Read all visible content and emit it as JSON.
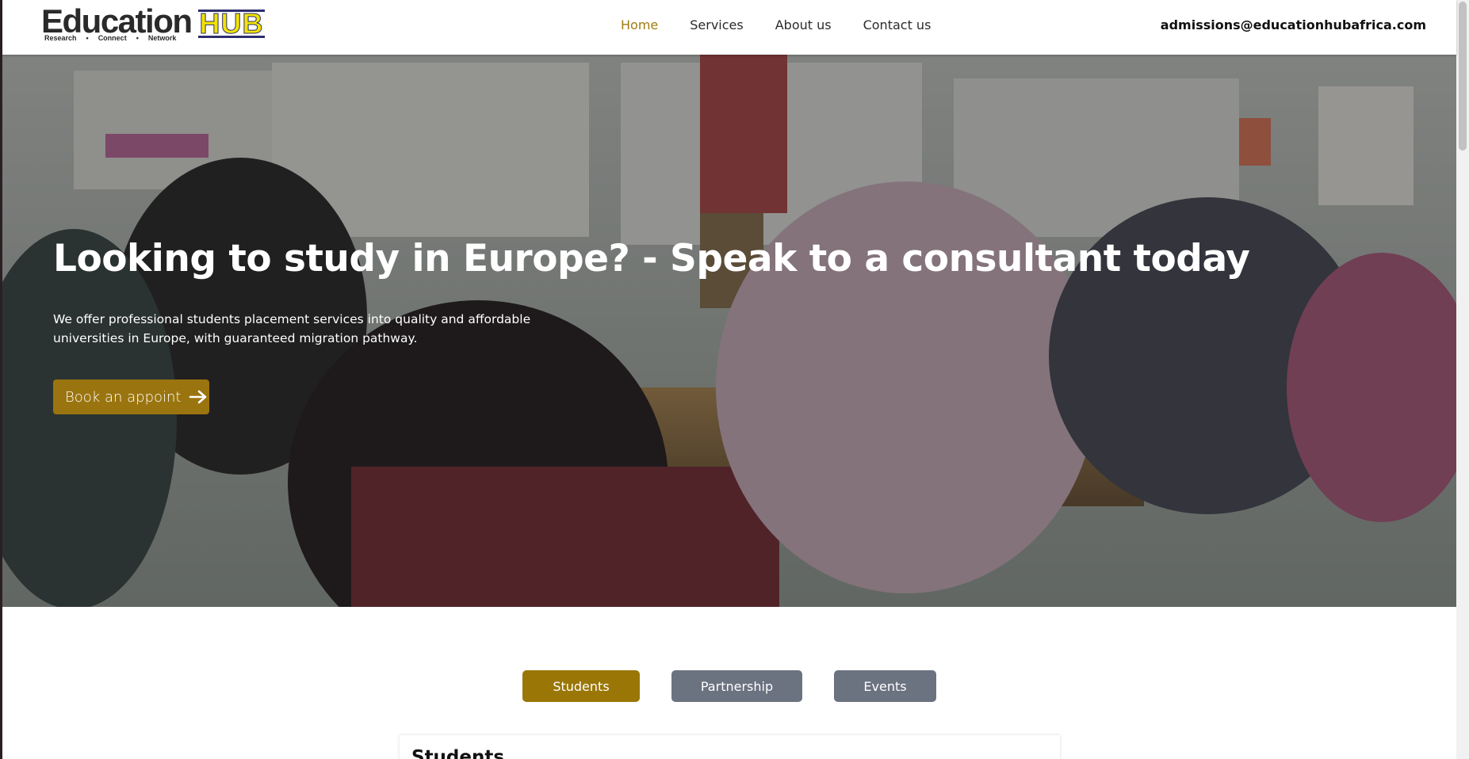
{
  "brand": {
    "logo_word": "Education",
    "logo_hub": "HUB",
    "tagline": [
      "Research",
      "Connect",
      "Network"
    ],
    "colors": {
      "gold": "#9a7606",
      "hub_yellow": "#f2e300",
      "hub_navy": "#2d2f6e",
      "gray_tab": "#6b7280"
    }
  },
  "nav": {
    "items": [
      {
        "label": "Home",
        "active": true
      },
      {
        "label": "Services",
        "active": false
      },
      {
        "label": "About us",
        "active": false
      },
      {
        "label": "Contact us",
        "active": false
      }
    ],
    "email": "admissions@educationhubafrica.com"
  },
  "hero": {
    "title": "Looking to study in Europe? - Speak to a consultant today",
    "text": "We offer professional students placement services into quality and affordable universities in Europe, with guaranteed migration pathway.",
    "button_label": "Book an appoint",
    "button_icon": "arrow-right-icon",
    "background": "classroom photo with teacher and students"
  },
  "tabs": [
    {
      "label": "Students",
      "active": true
    },
    {
      "label": "Partnership",
      "active": false
    },
    {
      "label": "Events",
      "active": false
    }
  ],
  "section": {
    "title": "Students"
  }
}
